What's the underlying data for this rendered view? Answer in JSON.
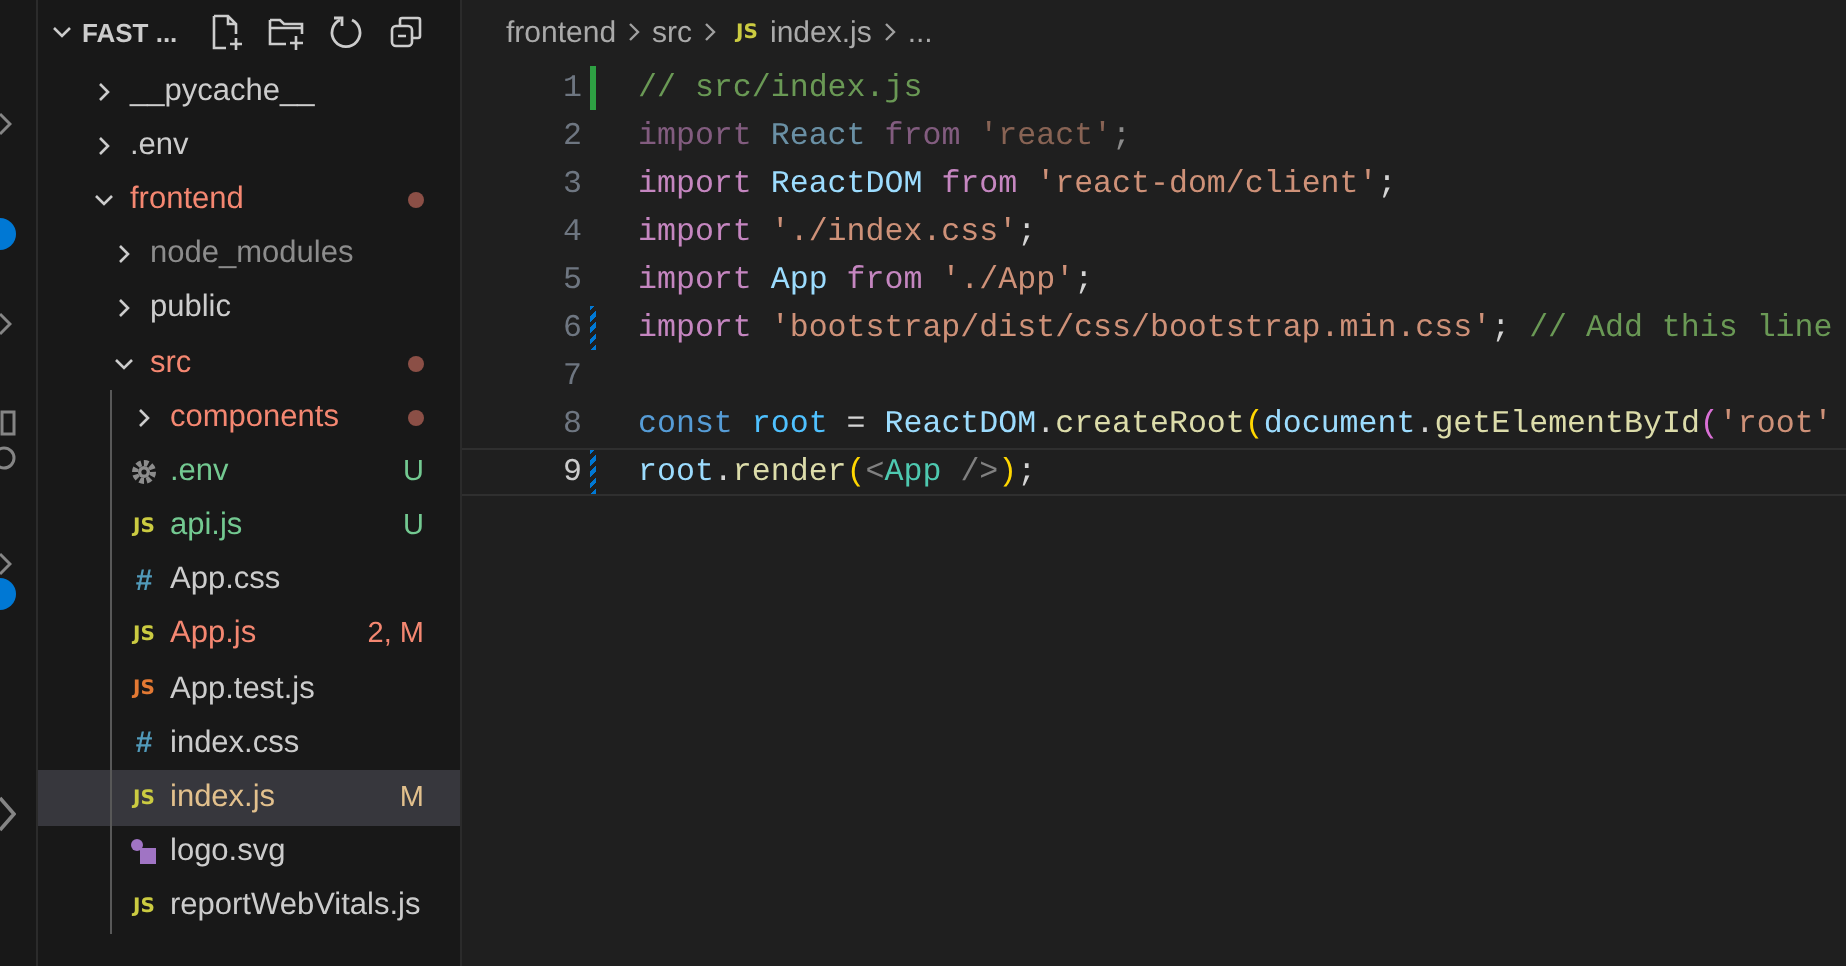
{
  "explorer": {
    "title": "FAST ...",
    "actions": [
      {
        "kind": "new-file"
      },
      {
        "kind": "new-folder"
      },
      {
        "kind": "refresh"
      },
      {
        "kind": "collapse"
      }
    ],
    "tree": [
      {
        "kind": "folder",
        "label": "__pycache__",
        "expanded": false,
        "color": "#cccccc",
        "dot": false,
        "selected": false
      },
      {
        "kind": "folder",
        "label": ".env",
        "expanded": false,
        "color": "#cccccc",
        "dot": false,
        "selected": false
      },
      {
        "kind": "folder",
        "label": "frontend",
        "expanded": true,
        "color": "#f48771",
        "dot": true,
        "selected": false,
        "children": [
          {
            "kind": "folder",
            "label": "node_modules",
            "expanded": false,
            "color": "#8c8c8c",
            "dot": false,
            "selected": false
          },
          {
            "kind": "folder",
            "label": "public",
            "expanded": false,
            "color": "#cccccc",
            "dot": false,
            "selected": false
          },
          {
            "kind": "folder",
            "label": "src",
            "expanded": true,
            "color": "#f48771",
            "dot": true,
            "selected": false,
            "children": [
              {
                "kind": "folder",
                "label": "components",
                "expanded": false,
                "color": "#f48771",
                "dot": true,
                "selected": false
              },
              {
                "kind": "env",
                "label": ".env",
                "color": "#73c991",
                "badge": "U",
                "selected": false
              },
              {
                "kind": "js",
                "icon": "JS",
                "label": "api.js",
                "color": "#73c991",
                "badge": "U",
                "selected": false
              },
              {
                "kind": "css",
                "icon": "#",
                "label": "App.css",
                "color": "#cccccc",
                "selected": false
              },
              {
                "kind": "js",
                "icon": "JS",
                "label": "App.js",
                "color": "#f48771",
                "badge": "2, M",
                "selected": false
              },
              {
                "kind": "test",
                "icon": "JS",
                "label": "App.test.js",
                "color": "#cccccc",
                "selected": false
              },
              {
                "kind": "css",
                "icon": "#",
                "label": "index.css",
                "color": "#cccccc",
                "selected": false
              },
              {
                "kind": "js",
                "icon": "JS",
                "label": "index.js",
                "color": "#e2c08d",
                "badge": "M",
                "selected": true
              },
              {
                "kind": "svg",
                "label": "logo.svg",
                "color": "#cccccc",
                "selected": false
              },
              {
                "kind": "js",
                "icon": "JS",
                "label": "reportWebVitals.js",
                "color": "#cccccc",
                "selected": false
              }
            ]
          }
        ]
      }
    ]
  },
  "breadcrumb": [
    {
      "kind": "folder",
      "label": "frontend"
    },
    {
      "kind": "folder",
      "label": "src"
    },
    {
      "kind": "js",
      "icon": "JS",
      "label": "index.js"
    },
    {
      "kind": "more",
      "label": "..."
    }
  ],
  "editor": {
    "lines": [
      {
        "number": "1",
        "active": false,
        "added": true,
        "modified": false,
        "faded": false,
        "tokens": [
          {
            "kind": "comment",
            "text": "// src/index.js"
          }
        ]
      },
      {
        "number": "2",
        "active": false,
        "added": false,
        "modified": false,
        "faded": true,
        "tokens": [
          {
            "kind": "kw",
            "text": "import"
          },
          {
            "kind": "var",
            "text": " React"
          },
          {
            "kind": "kw",
            "text": " from"
          },
          {
            "kind": "str",
            "text": " 'react'"
          },
          {
            "kind": "p",
            "text": ";"
          }
        ]
      },
      {
        "number": "3",
        "active": false,
        "added": false,
        "modified": false,
        "faded": false,
        "tokens": [
          {
            "kind": "kw",
            "text": "import"
          },
          {
            "kind": "var",
            "text": " ReactDOM"
          },
          {
            "kind": "kw",
            "text": " from"
          },
          {
            "kind": "str",
            "text": " 'react-dom/client'"
          },
          {
            "kind": "p",
            "text": ";"
          }
        ]
      },
      {
        "number": "4",
        "active": false,
        "added": false,
        "modified": false,
        "faded": false,
        "tokens": [
          {
            "kind": "kw",
            "text": "import"
          },
          {
            "kind": "str",
            "text": " './index.css'"
          },
          {
            "kind": "p",
            "text": ";"
          }
        ]
      },
      {
        "number": "5",
        "active": false,
        "added": false,
        "modified": false,
        "faded": false,
        "tokens": [
          {
            "kind": "kw",
            "text": "import"
          },
          {
            "kind": "var",
            "text": " App"
          },
          {
            "kind": "kw",
            "text": " from"
          },
          {
            "kind": "str",
            "text": " './App'"
          },
          {
            "kind": "p",
            "text": ";"
          }
        ]
      },
      {
        "number": "6",
        "active": false,
        "added": false,
        "modified": true,
        "faded": false,
        "tokens": [
          {
            "kind": "kw",
            "text": "import"
          },
          {
            "kind": "str",
            "text": " 'bootstrap/dist/css/bootstrap.min.css'"
          },
          {
            "kind": "p",
            "text": ";"
          },
          {
            "kind": "comment",
            "text": " // Add this line"
          }
        ]
      },
      {
        "number": "7",
        "active": false,
        "added": false,
        "modified": false
      },
      {
        "number": "8",
        "active": false,
        "added": false,
        "modified": false,
        "faded": false,
        "tokens": [
          {
            "kind": "const",
            "text": "const"
          },
          {
            "kind": "constvar",
            "text": " root"
          },
          {
            "kind": "p",
            "text": " ="
          },
          {
            "kind": "var",
            "text": " ReactDOM"
          },
          {
            "kind": "p",
            "text": "."
          },
          {
            "kind": "func",
            "text": "createRoot"
          },
          {
            "kind": "b1",
            "text": "("
          },
          {
            "kind": "var",
            "text": "document"
          },
          {
            "kind": "p",
            "text": "."
          },
          {
            "kind": "func",
            "text": "getElementById"
          },
          {
            "kind": "b2",
            "text": "("
          },
          {
            "kind": "str",
            "text": "'root'"
          }
        ]
      },
      {
        "number": "9",
        "active": true,
        "added": false,
        "modified": true,
        "faded": false,
        "tokens": [
          {
            "kind": "var",
            "text": "root"
          },
          {
            "kind": "p",
            "text": "."
          },
          {
            "kind": "func",
            "text": "render"
          },
          {
            "kind": "b1",
            "text": "("
          },
          {
            "kind": "tagp",
            "text": "<"
          },
          {
            "kind": "tag",
            "text": "App"
          },
          {
            "kind": "tagp",
            "text": " />"
          },
          {
            "kind": "b1",
            "text": ")"
          },
          {
            "kind": "p",
            "text": ";"
          }
        ]
      }
    ]
  }
}
